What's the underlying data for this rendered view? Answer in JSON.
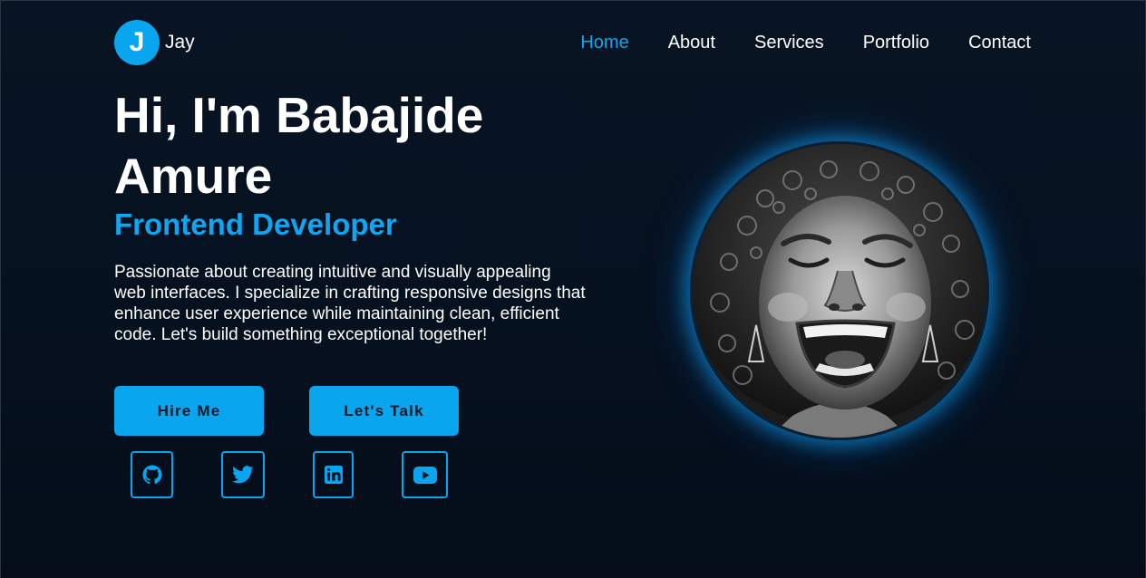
{
  "brand": {
    "initial": "J",
    "name": "Jay"
  },
  "nav": {
    "items": [
      {
        "label": "Home",
        "active": true
      },
      {
        "label": "About",
        "active": false
      },
      {
        "label": "Services",
        "active": false
      },
      {
        "label": "Portfolio",
        "active": false
      },
      {
        "label": "Contact",
        "active": false
      }
    ]
  },
  "hero": {
    "title": "Hi, I'm Babajide Amure",
    "role": "Frontend Developer",
    "description": "Passionate about creating intuitive and visually appealing web interfaces. I specialize in crafting responsive designs that enhance user experience while maintaining clean, efficient code. Let's build something exceptional together!"
  },
  "buttons": {
    "hire": "Hire Me",
    "talk": "Let's Talk"
  },
  "social": [
    {
      "icon": "github-icon"
    },
    {
      "icon": "twitter-icon"
    },
    {
      "icon": "linkedin-icon"
    },
    {
      "icon": "youtube-icon"
    }
  ],
  "colors": {
    "accent": "#0aa5ef",
    "background": "#061120",
    "text": "#ffffff",
    "button_text": "#0a1a2b"
  }
}
